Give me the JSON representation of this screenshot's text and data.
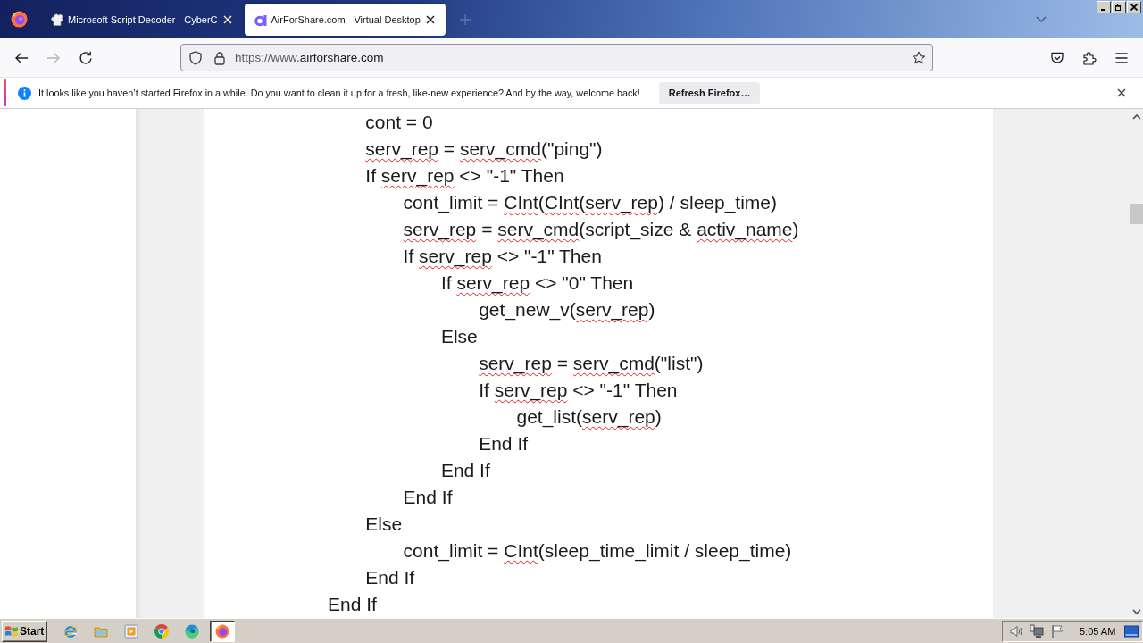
{
  "tabs": [
    {
      "title": "Microsoft Script Decoder - CyberC",
      "kind": "hat",
      "selected": false
    },
    {
      "title": "AirForShare.com - Virtual Desktop",
      "kind": "letter",
      "selected": true
    }
  ],
  "nav_buttons": [
    {
      "kind": "back",
      "disabled": false
    },
    {
      "kind": "forward",
      "disabled": true
    },
    {
      "kind": "reload",
      "disabled": false
    }
  ],
  "address_bar": {
    "url_prefix": "https://www.",
    "url_host": "airforshare.com"
  },
  "notification": {
    "message": "It looks like you haven’t started Firefox in a while. Do you want to clean it up for a fresh, like-new experience? And by the way, welcome back!",
    "button": "Refresh Firefox…"
  },
  "document": {
    "lines": [
      {
        "children": [
          {
            "segments": [
              {
                "text": "cont = 0",
                "misspelled": false
              }
            ]
          },
          {
            "segments": [
              {
                "text": "serv_rep",
                "misspelled": true
              },
              {
                "text": " = ",
                "misspelled": false
              },
              {
                "text": "serv_cmd",
                "misspelled": true
              },
              {
                "text": "(\"ping\")",
                "misspelled": false
              }
            ]
          },
          {
            "segments": [
              {
                "text": "If ",
                "misspelled": false
              },
              {
                "text": "serv_rep",
                "misspelled": true
              },
              {
                "text": " <> \"-1\" Then",
                "misspelled": false
              }
            ],
            "children": [
              {
                "segments": [
                  {
                    "text": "cont_limit = ",
                    "misspelled": false
                  },
                  {
                    "text": "CInt",
                    "misspelled": true
                  },
                  {
                    "text": "(",
                    "misspelled": false
                  },
                  {
                    "text": "CInt",
                    "misspelled": true
                  },
                  {
                    "text": "(",
                    "misspelled": false
                  },
                  {
                    "text": "serv_rep",
                    "misspelled": true
                  },
                  {
                    "text": ") / sleep_time)",
                    "misspelled": false
                  }
                ]
              },
              {
                "segments": [
                  {
                    "text": "serv_rep",
                    "misspelled": true
                  },
                  {
                    "text": " = ",
                    "misspelled": false
                  },
                  {
                    "text": "serv_cmd",
                    "misspelled": true
                  },
                  {
                    "text": "(script_size & ",
                    "misspelled": false
                  },
                  {
                    "text": "activ_name",
                    "misspelled": true
                  },
                  {
                    "text": ")",
                    "misspelled": false
                  }
                ]
              },
              {
                "segments": [
                  {
                    "text": "If ",
                    "misspelled": false
                  },
                  {
                    "text": "serv_rep",
                    "misspelled": true
                  },
                  {
                    "text": " <> \"-1\" Then",
                    "misspelled": false
                  }
                ],
                "children": [
                  {
                    "segments": [
                      {
                        "text": "If ",
                        "misspelled": false
                      },
                      {
                        "text": "serv_rep",
                        "misspelled": true
                      },
                      {
                        "text": " <> \"0\" Then",
                        "misspelled": false
                      }
                    ],
                    "children": [
                      {
                        "segments": [
                          {
                            "text": "get_new_v(",
                            "misspelled": false
                          },
                          {
                            "text": "serv_rep",
                            "misspelled": true
                          },
                          {
                            "text": ")",
                            "misspelled": false
                          }
                        ]
                      }
                    ]
                  },
                  {
                    "segments": [
                      {
                        "text": "Else",
                        "misspelled": false
                      }
                    ],
                    "children": [
                      {
                        "segments": [
                          {
                            "text": "serv_rep",
                            "misspelled": true
                          },
                          {
                            "text": " = ",
                            "misspelled": false
                          },
                          {
                            "text": "serv_cmd",
                            "misspelled": true
                          },
                          {
                            "text": "(\"list\")",
                            "misspelled": false
                          }
                        ]
                      },
                      {
                        "segments": [
                          {
                            "text": "If ",
                            "misspelled": false
                          },
                          {
                            "text": "serv_rep",
                            "misspelled": true
                          },
                          {
                            "text": " <> \"-1\" Then",
                            "misspelled": false
                          }
                        ],
                        "children": [
                          {
                            "segments": [
                              {
                                "text": "get_list(",
                                "misspelled": false
                              },
                              {
                                "text": "serv_rep",
                                "misspelled": true
                              },
                              {
                                "text": ")",
                                "misspelled": false
                              }
                            ]
                          }
                        ]
                      },
                      {
                        "segments": [
                          {
                            "text": "End If",
                            "misspelled": false
                          }
                        ]
                      }
                    ]
                  },
                  {
                    "segments": [
                      {
                        "text": "End If",
                        "misspelled": false
                      }
                    ]
                  }
                ]
              },
              {
                "segments": [
                  {
                    "text": "End If",
                    "misspelled": false
                  }
                ]
              }
            ]
          },
          {
            "segments": [
              {
                "text": "Else",
                "misspelled": false
              }
            ],
            "children": [
              {
                "segments": [
                  {
                    "text": "cont_limit = ",
                    "misspelled": false
                  },
                  {
                    "text": "CInt",
                    "misspelled": true
                  },
                  {
                    "text": "(sleep_time_limit / sleep_time)",
                    "misspelled": false
                  }
                ]
              }
            ]
          },
          {
            "segments": [
              {
                "text": "End If",
                "misspelled": false
              }
            ]
          }
        ]
      },
      {
        "segments": [
          {
            "text": "End If",
            "misspelled": false
          }
        ]
      }
    ]
  },
  "taskbar": {
    "start_label": "Start",
    "apps": [
      {
        "kind": "e-logo",
        "selected": false
      },
      {
        "kind": "folder",
        "selected": false
      },
      {
        "kind": "play",
        "selected": false
      },
      {
        "kind": "ring",
        "selected": false
      },
      {
        "kind": "swirl",
        "selected": false
      },
      {
        "kind": "globe",
        "selected": true
      }
    ],
    "clock": "5:05 AM"
  }
}
